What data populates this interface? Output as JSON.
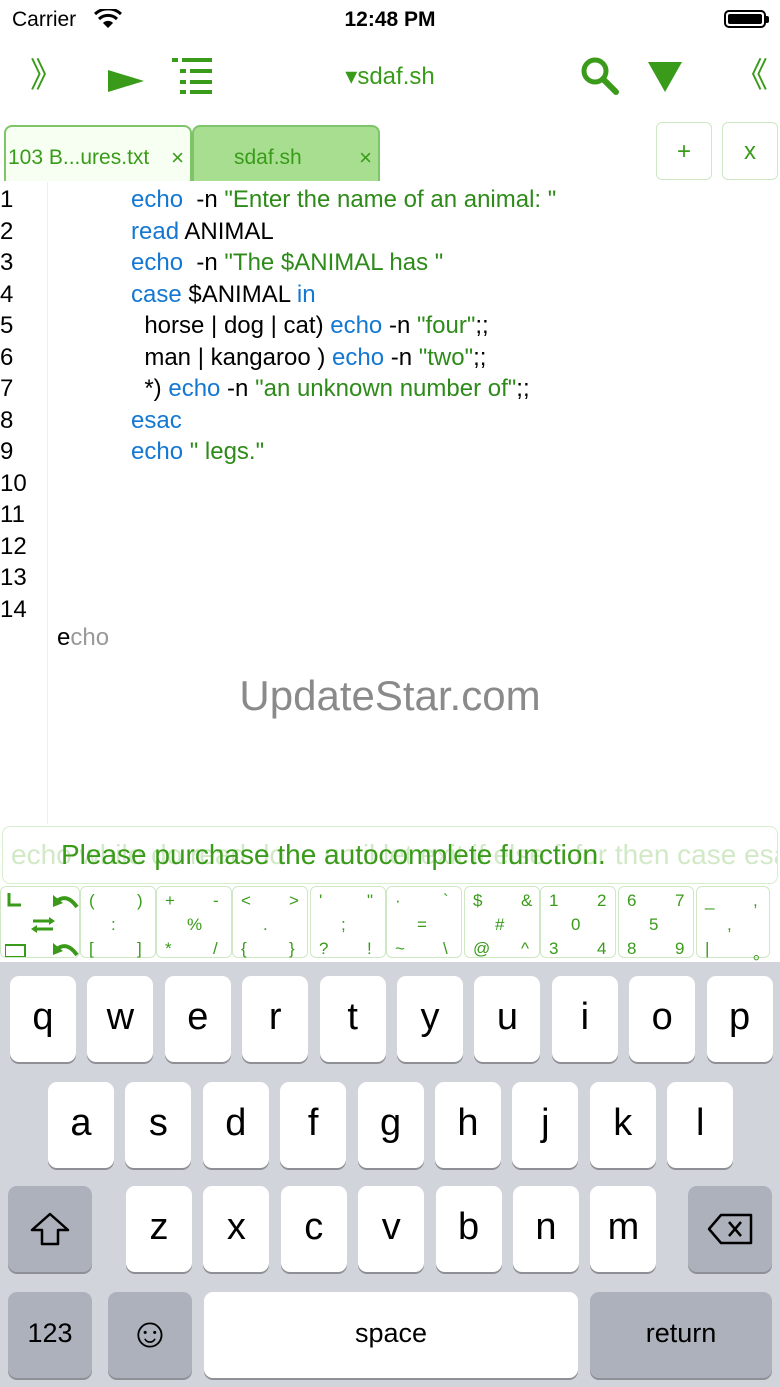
{
  "status": {
    "carrier": "Carrier",
    "time": "12:48 PM"
  },
  "toolbar": {
    "file_title": "▾sdaf.sh",
    "sidebar_toggle": "》",
    "collapse_toggle": "《"
  },
  "tabs": [
    {
      "label": "103 B...ures.txt",
      "close": "×"
    },
    {
      "label": "sdaf.sh",
      "close": "×"
    }
  ],
  "tab_actions": {
    "add": "+",
    "close": "x"
  },
  "editor": {
    "line_numbers": [
      "1",
      "2",
      "3",
      "4",
      "5",
      "6",
      "7",
      "8",
      "9",
      "10",
      "11",
      "12",
      "13",
      "14"
    ],
    "lines": [
      [
        [
          "kw",
          "echo"
        ],
        [
          "",
          "  -n "
        ],
        [
          "str",
          "\"Enter the name of an animal: \""
        ]
      ],
      [
        [
          "kw",
          "read"
        ],
        [
          "",
          " ANIMAL"
        ]
      ],
      [
        [
          "kw",
          "echo"
        ],
        [
          "",
          "  -n "
        ],
        [
          "str",
          "\"The $ANIMAL has \""
        ]
      ],
      [
        [
          "kw",
          "case"
        ],
        [
          "",
          " $ANIMAL "
        ],
        [
          "kw",
          "in"
        ]
      ],
      [
        [
          "",
          "  horse | dog | cat) "
        ],
        [
          "kw",
          "echo"
        ],
        [
          "",
          " -n "
        ],
        [
          "str",
          "\"four\""
        ],
        [
          "",
          ";;"
        ]
      ],
      [
        [
          "",
          "  man | kangaroo ) "
        ],
        [
          "kw",
          "echo"
        ],
        [
          "",
          " -n "
        ],
        [
          "str",
          "\"two\""
        ],
        [
          "",
          ";;"
        ]
      ],
      [
        [
          "",
          "  *) "
        ],
        [
          "kw",
          "echo"
        ],
        [
          "",
          " -n "
        ],
        [
          "str",
          "\"an unknown number of\""
        ],
        [
          "",
          ";;"
        ]
      ],
      [
        [
          "kw",
          "esac"
        ]
      ],
      [
        [
          "kw",
          "echo"
        ],
        [
          "str",
          " \" legs.\""
        ]
      ]
    ],
    "ghost_typed": "e",
    "ghost_rest": "cho",
    "watermark": "UpdateStar.com"
  },
  "autocomplete": {
    "background": "echo   while   do   read   done   until   let   exit   if   else   fi   for   then   case   esac",
    "message": "Please purchase the autocomplete function."
  },
  "symbols": [
    [
      "(",
      ")",
      ":",
      "[",
      "]"
    ],
    [
      "+",
      "-",
      "%",
      "*",
      "/"
    ],
    [
      "<",
      ">",
      ".",
      "{",
      "}"
    ],
    [
      "'",
      "\"",
      ";",
      "?",
      "!"
    ],
    [
      "·",
      "`",
      "=",
      "~",
      "\\"
    ],
    [
      "$",
      "&",
      "#",
      "@",
      "^"
    ],
    [
      "1",
      "2",
      "0",
      "3",
      "4"
    ],
    [
      "6",
      "7",
      "5",
      "8",
      "9"
    ],
    [
      "_",
      ",",
      ",",
      "|",
      "。"
    ]
  ],
  "keyboard": {
    "row1": [
      "q",
      "w",
      "e",
      "r",
      "t",
      "y",
      "u",
      "i",
      "o",
      "p"
    ],
    "row2": [
      "a",
      "s",
      "d",
      "f",
      "g",
      "h",
      "j",
      "k",
      "l"
    ],
    "row3": [
      "z",
      "x",
      "c",
      "v",
      "b",
      "n",
      "m"
    ],
    "numbers": "123",
    "space": "space",
    "return": "return",
    "emoji": "☺"
  },
  "colors": {
    "accent": "#3a9b1a",
    "keyword": "#1478d2",
    "string": "#2e8b1a",
    "keyboard_bg": "#d1d4da"
  }
}
